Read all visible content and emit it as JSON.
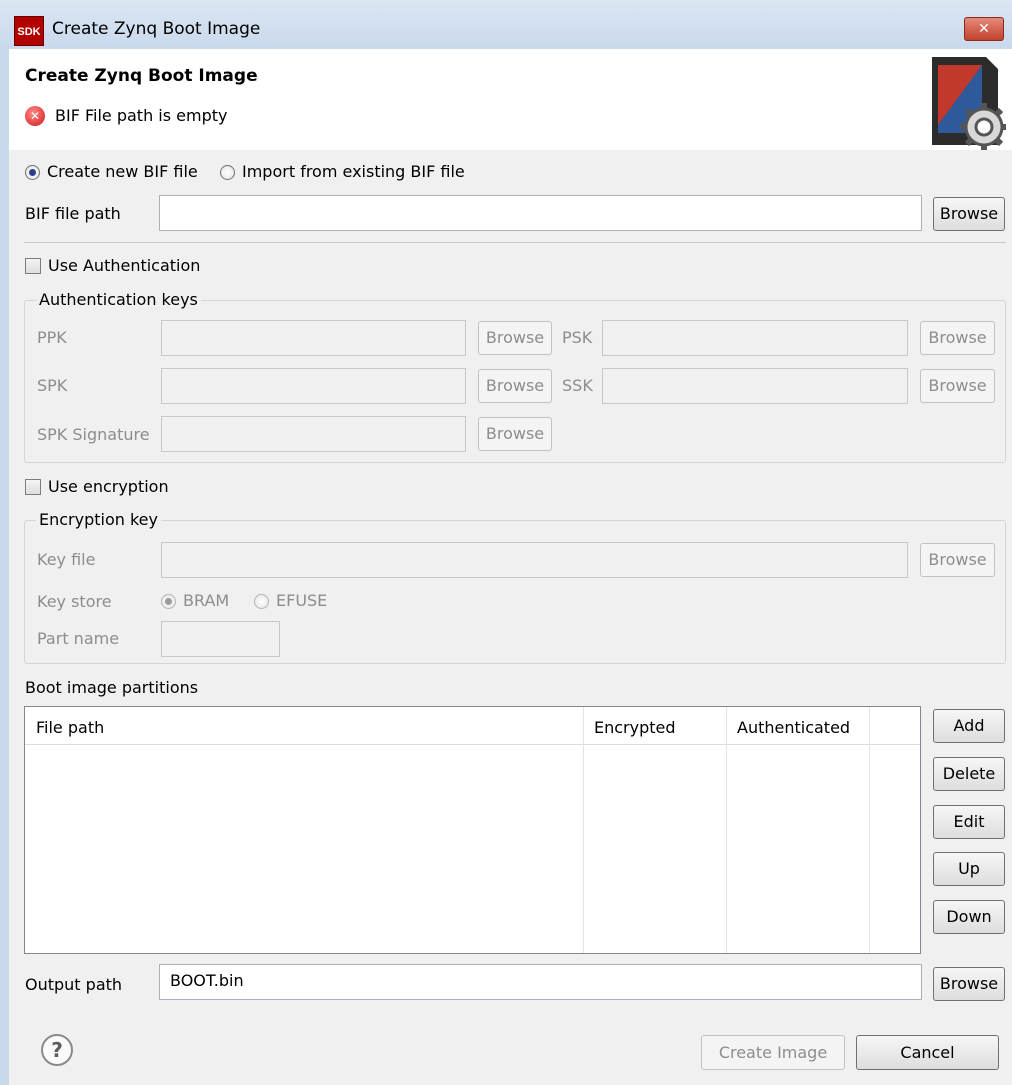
{
  "window": {
    "app_badge": "SDK",
    "title": "Create Zynq Boot Image",
    "close_glyph": "✕"
  },
  "header": {
    "title": "Create Zynq Boot Image",
    "error_glyph": "✕",
    "error_message": "BIF File path is empty",
    "graphic_icon": "sd-card-gear-icon"
  },
  "bif": {
    "create_option": "Create new BIF file",
    "import_option": "Import from existing BIF file",
    "selected": "create",
    "path_label": "BIF file path",
    "path_value": "",
    "browse_label": "Browse"
  },
  "authentication": {
    "use_label": "Use Authentication",
    "checked": false,
    "group_title": "Authentication keys",
    "ppk_label": "PPK",
    "psk_label": "PSK",
    "spk_label": "SPK",
    "ssk_label": "SSK",
    "spk_signature_label": "SPK Signature",
    "browse_label": "Browse"
  },
  "encryption": {
    "use_label": "Use encryption",
    "checked": false,
    "group_title": "Encryption key",
    "key_file_label": "Key file",
    "key_store_label": "Key store",
    "bram_label": "BRAM",
    "efuse_label": "EFUSE",
    "selected_store": "BRAM",
    "part_name_label": "Part name",
    "browse_label": "Browse"
  },
  "partitions": {
    "title": "Boot image partitions",
    "columns": [
      "File path",
      "Encrypted",
      "Authenticated"
    ],
    "rows": [],
    "buttons": {
      "add": "Add",
      "delete": "Delete",
      "edit": "Edit",
      "up": "Up",
      "down": "Down"
    }
  },
  "output": {
    "label": "Output path",
    "value": "BOOT.bin",
    "browse_label": "Browse"
  },
  "footer": {
    "help_glyph": "?",
    "create_label": "Create Image",
    "cancel_label": "Cancel"
  }
}
